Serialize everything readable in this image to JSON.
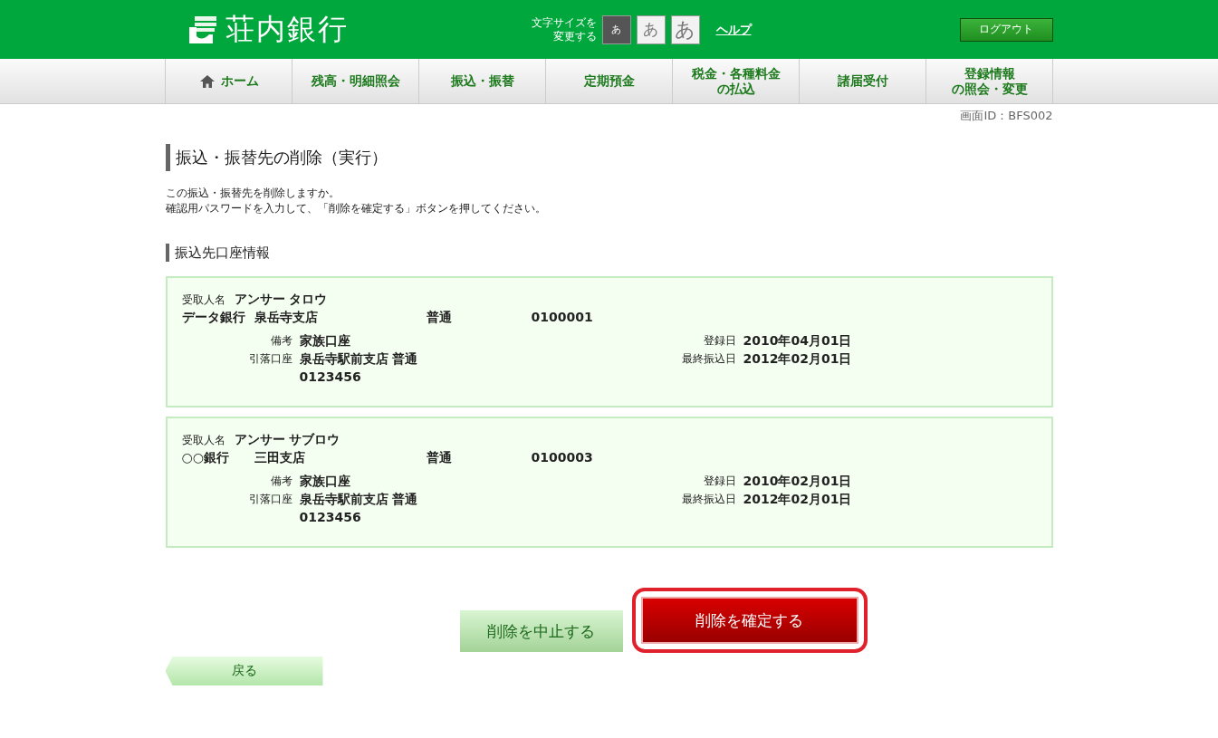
{
  "header": {
    "logo": "荘内銀行",
    "font_size_label": [
      "文字サイズを",
      "変更する"
    ],
    "font_sizes": [
      {
        "label": "あ",
        "kind": "small",
        "selected": true
      },
      {
        "label": "あ",
        "kind": "medium",
        "selected": false
      },
      {
        "label": "あ",
        "kind": "large",
        "selected": false
      }
    ],
    "help_link": "ヘルプ",
    "logout_button": "ログアウト"
  },
  "nav": [
    {
      "kind": "home",
      "lines": [
        "ホーム"
      ]
    },
    {
      "kind": "text",
      "lines": [
        "残高・明細照会"
      ]
    },
    {
      "kind": "text",
      "lines": [
        "振込・振替"
      ]
    },
    {
      "kind": "text",
      "lines": [
        "定期預金"
      ]
    },
    {
      "kind": "text",
      "lines": [
        "税金・各種料金",
        "の払込"
      ]
    },
    {
      "kind": "text",
      "lines": [
        "諸届受付"
      ]
    },
    {
      "kind": "text",
      "lines": [
        "登録情報",
        "の照会・変更"
      ]
    }
  ],
  "screen_id": "画面ID：BFS002",
  "page_title": "振込・振替先の削除（実行）",
  "intro": [
    "この振込・振替先を削除しますか。",
    "確認用パスワードを入力して、「削除を確定する」ボタンを押してください。"
  ],
  "section_title": "振込先口座情報",
  "payees": [
    {
      "name_label": "受取人名",
      "name": "アンサー タロウ",
      "bank": "データ銀行",
      "branch": "泉岳寺支店",
      "account_type": "普通",
      "account_number": "0100001",
      "left": [
        {
          "label": "備考",
          "lines": [
            "家族口座"
          ]
        },
        {
          "label": "引落口座",
          "lines": [
            "泉岳寺駅前支店 普通",
            "0123456"
          ]
        }
      ],
      "right": [
        {
          "label": "登録日",
          "lines": [
            "2010年04月01日"
          ]
        },
        {
          "label": "最終振込日",
          "lines": [
            "2012年02月01日"
          ]
        }
      ]
    },
    {
      "name_label": "受取人名",
      "name": "アンサー サブロウ",
      "bank": "○○銀行",
      "branch": "三田支店",
      "account_type": "普通",
      "account_number": "0100003",
      "left": [
        {
          "label": "備考",
          "lines": [
            "家族口座"
          ]
        },
        {
          "label": "引落口座",
          "lines": [
            "泉岳寺駅前支店 普通",
            "0123456"
          ]
        }
      ],
      "right": [
        {
          "label": "登録日",
          "lines": [
            "2010年02月01日"
          ]
        },
        {
          "label": "最終振込日",
          "lines": [
            "2012年02月01日"
          ]
        }
      ]
    }
  ],
  "actions": {
    "cancel": "削除を中止する",
    "confirm": {
      "label": "削除を確定する",
      "highlighted": true
    }
  },
  "back_button": "戻る"
}
